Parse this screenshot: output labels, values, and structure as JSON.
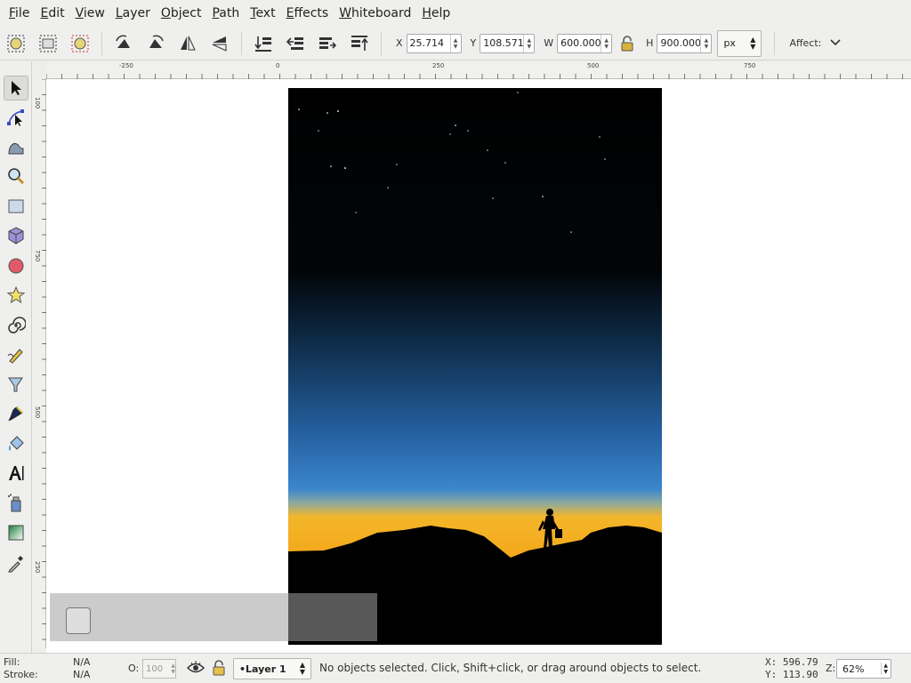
{
  "menu": [
    "File",
    "Edit",
    "View",
    "Layer",
    "Object",
    "Path",
    "Text",
    "Effects",
    "Whiteboard",
    "Help"
  ],
  "controls": {
    "x_label": "X",
    "x_value": "25.714",
    "y_label": "Y",
    "y_value": "108.571",
    "w_label": "W",
    "w_value": "600.000",
    "h_label": "H",
    "h_value": "900.000",
    "unit": "px",
    "affect_label": "Affect:"
  },
  "rulers": {
    "horizontal": [
      "-250",
      "0",
      "250",
      "500",
      "750"
    ],
    "vertical": [
      "100",
      "750",
      "500",
      "250"
    ]
  },
  "tools": [
    "selector-tool-icon",
    "node-tool-icon",
    "tweak-tool-icon",
    "zoom-tool-icon",
    "rect-tool-icon",
    "3d-box-tool-icon",
    "ellipse-tool-icon",
    "star-tool-icon",
    "spiral-tool-icon",
    "pencil-tool-icon",
    "pen-tool-icon",
    "calligraphy-tool-icon",
    "paint-bucket-tool-icon",
    "text-tool-icon",
    "spray-tool-icon",
    "gradient-tool-icon",
    "dropper-tool-icon"
  ],
  "status": {
    "fill_label": "Fill:",
    "fill_value": "N/A",
    "stroke_label": "Stroke:",
    "stroke_value": "N/A",
    "opacity_label": "O:",
    "opacity_value": "100",
    "layer": "•Layer 1",
    "message": "No objects selected. Click, Shift+click, or drag around objects to select.",
    "cursor_x": "X: 596.79",
    "cursor_y": "Y: 113.90",
    "zoom_label": "Z:",
    "zoom": "62%"
  },
  "colors": {
    "sky_top": "#000000",
    "sky_mid": "#2c6aa6",
    "horizon": "#f2a219",
    "ground": "#000000"
  }
}
